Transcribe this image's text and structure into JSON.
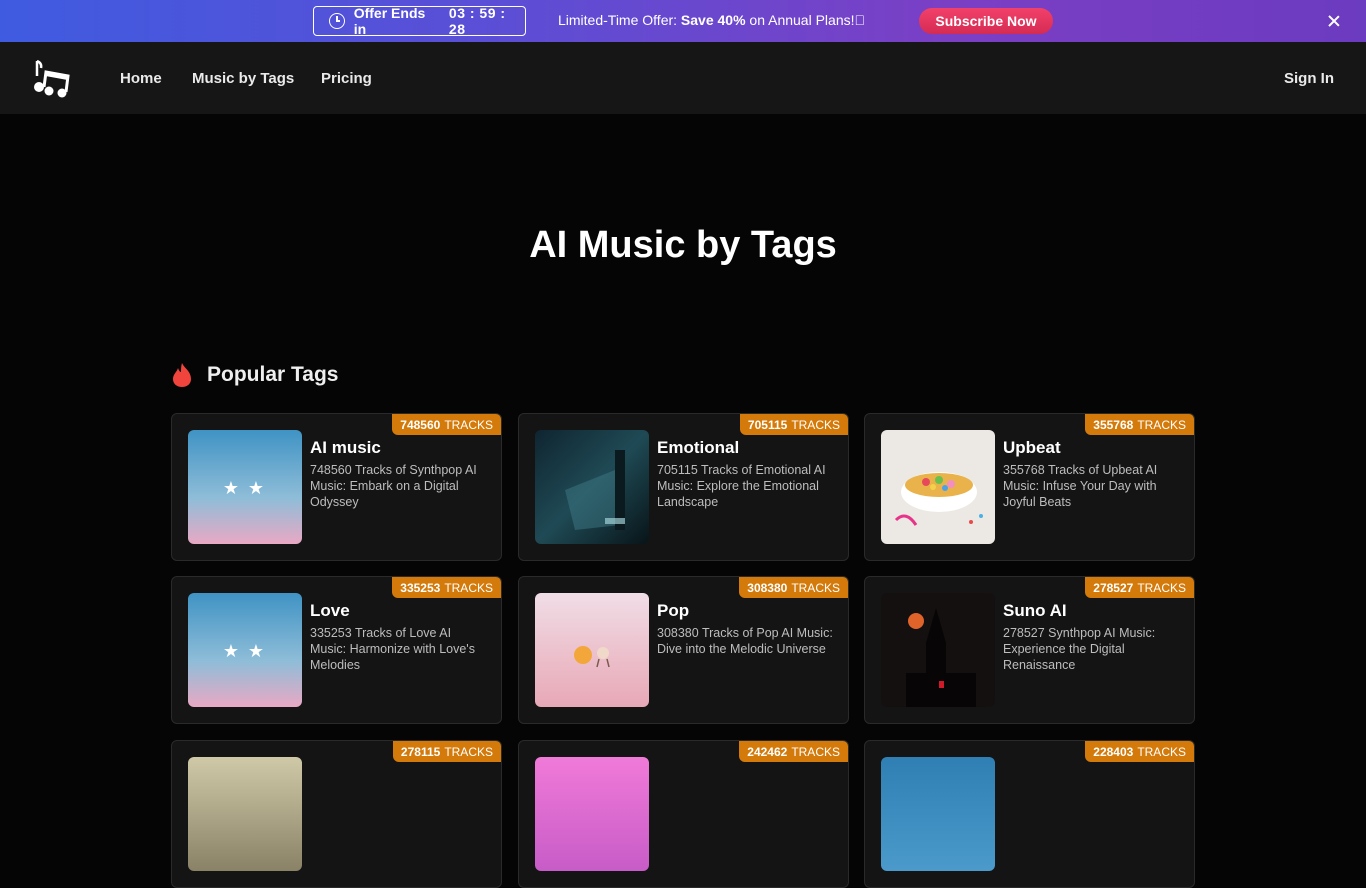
{
  "promo": {
    "timer_label": "Offer Ends in",
    "countdown": "03 : 59 : 28",
    "offer_prefix": "Limited-Time Offer: ",
    "offer_bold": "Save 40%",
    "offer_suffix": " on Annual Plans!",
    "offer_emoji": "🏼",
    "subscribe_label": "Subscribe Now"
  },
  "nav": {
    "items": [
      "Home",
      "Music by Tags",
      "Pricing"
    ],
    "signin_label": "Sign In"
  },
  "page": {
    "title": "AI Music by Tags",
    "section_title": "Popular Tags"
  },
  "cards": [
    {
      "count": "748560",
      "unit": "TRACKS",
      "title": "AI music",
      "desc": "748560 Tracks of Synthpop AI Music: Embark on a Digital Odyssey"
    },
    {
      "count": "705115",
      "unit": "TRACKS",
      "title": "Emotional",
      "desc": "705115 Tracks of Emotional AI Music: Explore the Emotional Landscape"
    },
    {
      "count": "355768",
      "unit": "TRACKS",
      "title": "Upbeat",
      "desc": "355768 Tracks of Upbeat AI Music: Infuse Your Day with Joyful Beats"
    },
    {
      "count": "335253",
      "unit": "TRACKS",
      "title": "Love",
      "desc": "335253 Tracks of Love AI Music: Harmonize with Love's Melodies"
    },
    {
      "count": "308380",
      "unit": "TRACKS",
      "title": "Pop",
      "desc": "308380 Tracks of Pop AI Music: Dive into the Melodic Universe"
    },
    {
      "count": "278527",
      "unit": "TRACKS",
      "title": "Suno AI",
      "desc": "278527 Synthpop AI Music: Experience the Digital Renaissance"
    },
    {
      "count": "278115",
      "unit": "TRACKS",
      "title": "",
      "desc": ""
    },
    {
      "count": "242462",
      "unit": "TRACKS",
      "title": "",
      "desc": ""
    },
    {
      "count": "228403",
      "unit": "TRACKS",
      "title": "",
      "desc": ""
    }
  ],
  "colors": {
    "accent": "#d47a0b",
    "subscribe": "#e8365e",
    "flame": "#f0443c"
  }
}
